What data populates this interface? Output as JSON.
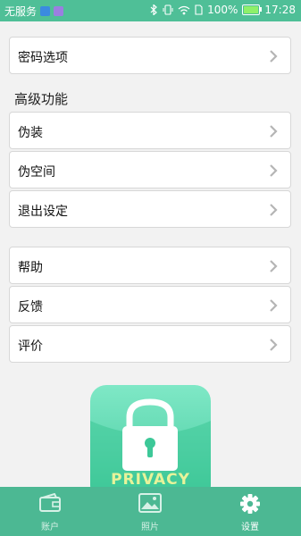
{
  "status_bar": {
    "carrier": "无服务",
    "battery": "100%",
    "battery_level": 1.0,
    "time": "17:28",
    "icons": [
      "bluetooth-icon",
      "vibrate-icon",
      "wifi-icon",
      "sim-icon",
      "battery-icon"
    ]
  },
  "settings": {
    "password_options": "密码选项",
    "advanced_title": "高级功能",
    "disguise": "伪装",
    "fake_space": "伪空间",
    "exit_settings": "退出设定",
    "help": "帮助",
    "feedback": "反馈",
    "rate": "评价"
  },
  "promo": {
    "text": "PRIVACY"
  },
  "bottom_nav": {
    "tabs": [
      {
        "label": "账户",
        "icon": "wallet-icon",
        "active": false
      },
      {
        "label": "照片",
        "icon": "photo-icon",
        "active": false
      },
      {
        "label": "设置",
        "icon": "gear-icon",
        "active": true
      }
    ]
  },
  "colors": {
    "accent": "#4fbf97",
    "nav_bg": "#4cb893",
    "promo_green": "#3dc898"
  }
}
